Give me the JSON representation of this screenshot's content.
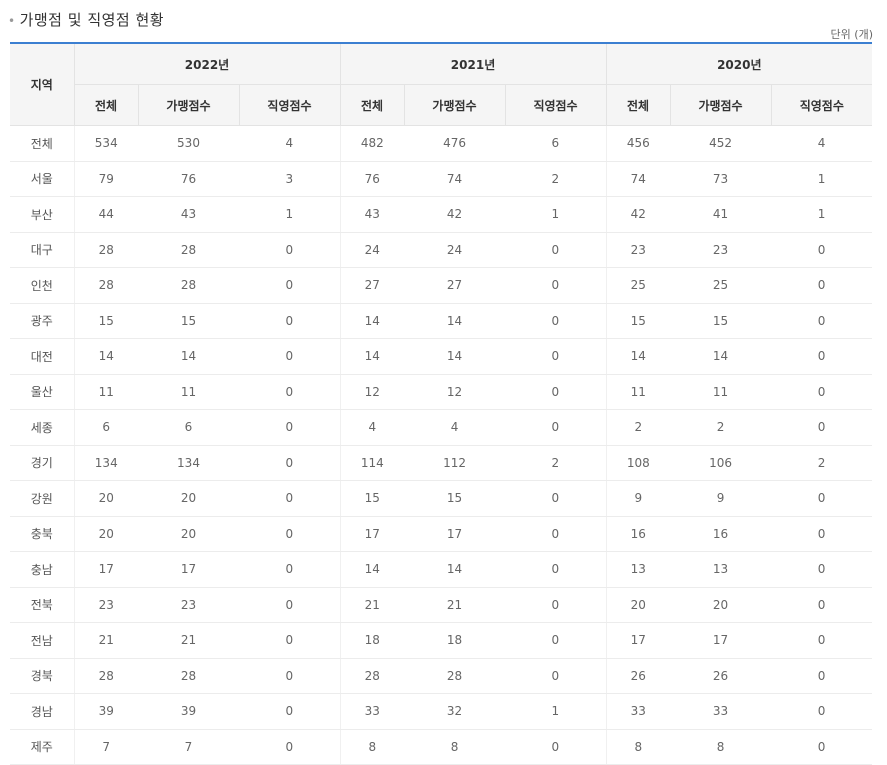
{
  "title": "가맹점 및 직영점 현황",
  "unit": "단위 (개)",
  "table": {
    "region_header": "지역",
    "years": [
      "2022년",
      "2021년",
      "2020년"
    ],
    "sub_headers": [
      "전체",
      "가맹점수",
      "직영점수",
      "전체",
      "가맹점수",
      "직영점수",
      "전체",
      "가맹점수",
      "직영점수"
    ],
    "rows": [
      [
        "전체",
        "534",
        "530",
        "4",
        "482",
        "476",
        "6",
        "456",
        "452",
        "4"
      ],
      [
        "서울",
        "79",
        "76",
        "3",
        "76",
        "74",
        "2",
        "74",
        "73",
        "1"
      ],
      [
        "부산",
        "44",
        "43",
        "1",
        "43",
        "42",
        "1",
        "42",
        "41",
        "1"
      ],
      [
        "대구",
        "28",
        "28",
        "0",
        "24",
        "24",
        "0",
        "23",
        "23",
        "0"
      ],
      [
        "인천",
        "28",
        "28",
        "0",
        "27",
        "27",
        "0",
        "25",
        "25",
        "0"
      ],
      [
        "광주",
        "15",
        "15",
        "0",
        "14",
        "14",
        "0",
        "15",
        "15",
        "0"
      ],
      [
        "대전",
        "14",
        "14",
        "0",
        "14",
        "14",
        "0",
        "14",
        "14",
        "0"
      ],
      [
        "울산",
        "11",
        "11",
        "0",
        "12",
        "12",
        "0",
        "11",
        "11",
        "0"
      ],
      [
        "세종",
        "6",
        "6",
        "0",
        "4",
        "4",
        "0",
        "2",
        "2",
        "0"
      ],
      [
        "경기",
        "134",
        "134",
        "0",
        "114",
        "112",
        "2",
        "108",
        "106",
        "2"
      ],
      [
        "강원",
        "20",
        "20",
        "0",
        "15",
        "15",
        "0",
        "9",
        "9",
        "0"
      ],
      [
        "충북",
        "20",
        "20",
        "0",
        "17",
        "17",
        "0",
        "16",
        "16",
        "0"
      ],
      [
        "충남",
        "17",
        "17",
        "0",
        "14",
        "14",
        "0",
        "13",
        "13",
        "0"
      ],
      [
        "전북",
        "23",
        "23",
        "0",
        "21",
        "21",
        "0",
        "20",
        "20",
        "0"
      ],
      [
        "전남",
        "21",
        "21",
        "0",
        "18",
        "18",
        "0",
        "17",
        "17",
        "0"
      ],
      [
        "경북",
        "28",
        "28",
        "0",
        "28",
        "28",
        "0",
        "26",
        "26",
        "0"
      ],
      [
        "경남",
        "39",
        "39",
        "0",
        "33",
        "32",
        "1",
        "33",
        "33",
        "0"
      ],
      [
        "제주",
        "7",
        "7",
        "0",
        "8",
        "8",
        "0",
        "8",
        "8",
        "0"
      ]
    ]
  },
  "colors": {
    "accent_border": "#3b7fd1",
    "header_bg": "#f5f5f5"
  }
}
